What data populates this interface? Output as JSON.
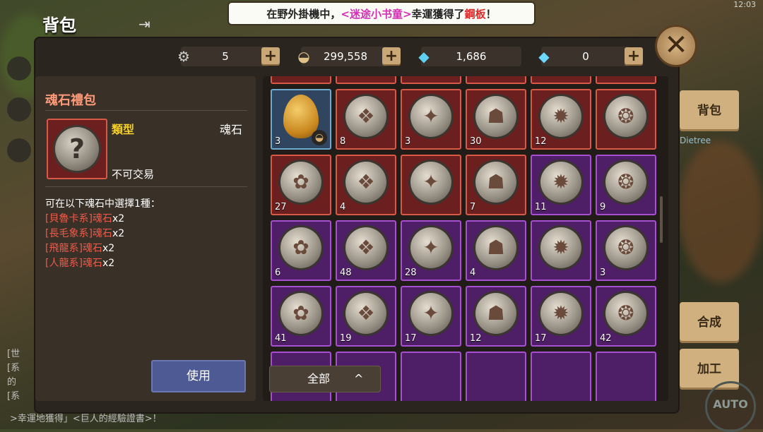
{
  "notice": {
    "prefix": "在野外掛機中，",
    "player": "<迷途小书童>",
    "middle": "幸運獲得了",
    "item": "鋼板",
    "suffix": "！"
  },
  "status": {
    "time": "12:03"
  },
  "window": {
    "title": "背包"
  },
  "currencies": [
    {
      "icon": "gear-coin-icon",
      "value": "5"
    },
    {
      "icon": "shell-icon",
      "value": "299,558"
    },
    {
      "icon": "locked-diamond-icon",
      "value": "1,686"
    },
    {
      "icon": "diamond-icon",
      "value": "0"
    }
  ],
  "detail": {
    "name": "魂石禮包",
    "type_label": "類型",
    "type_value": "魂石",
    "trade": "不可交易",
    "choose_text": "可在以下魂石中選擇1種：",
    "options": [
      {
        "bracket": "[貝魯卡系]魂石",
        "qty": "x2"
      },
      {
        "bracket": "[長毛象系]魂石",
        "qty": "x2"
      },
      {
        "bracket": "[飛龍系]魂石",
        "qty": "x2"
      },
      {
        "bracket": "[人龍系]魂石",
        "qty": "x2"
      }
    ],
    "use_button": "使用"
  },
  "grid": [
    {
      "kind": "egg",
      "count": "3"
    },
    {
      "kind": "red",
      "count": "8"
    },
    {
      "kind": "red",
      "count": "3"
    },
    {
      "kind": "red",
      "count": "30"
    },
    {
      "kind": "red",
      "count": "12"
    },
    {
      "kind": "red",
      "count": ""
    },
    {
      "kind": "red",
      "count": "27"
    },
    {
      "kind": "red",
      "count": "4"
    },
    {
      "kind": "red",
      "count": ""
    },
    {
      "kind": "red",
      "count": "7"
    },
    {
      "kind": "purple",
      "count": "11"
    },
    {
      "kind": "purple",
      "count": "9"
    },
    {
      "kind": "purple",
      "count": "6"
    },
    {
      "kind": "purple",
      "count": "48"
    },
    {
      "kind": "purple",
      "count": "28"
    },
    {
      "kind": "purple",
      "count": "4"
    },
    {
      "kind": "purple",
      "count": ""
    },
    {
      "kind": "purple",
      "count": "3"
    },
    {
      "kind": "purple",
      "count": "41"
    },
    {
      "kind": "purple",
      "count": "19"
    },
    {
      "kind": "purple",
      "count": "17"
    },
    {
      "kind": "purple",
      "count": "12"
    },
    {
      "kind": "purple",
      "count": "17"
    },
    {
      "kind": "purple",
      "count": "42"
    }
  ],
  "filter": {
    "label": "全部",
    "arrow": "^"
  },
  "side_tabs": {
    "bag": "背包",
    "craft": "合成",
    "process": "加工"
  },
  "auto": "AUTO",
  "bg_name": "Dietree",
  "chat": [
    "[世",
    "[系",
    "的",
    "[系",
    ">幸運地獲得」<巨人的經驗證書>！"
  ]
}
